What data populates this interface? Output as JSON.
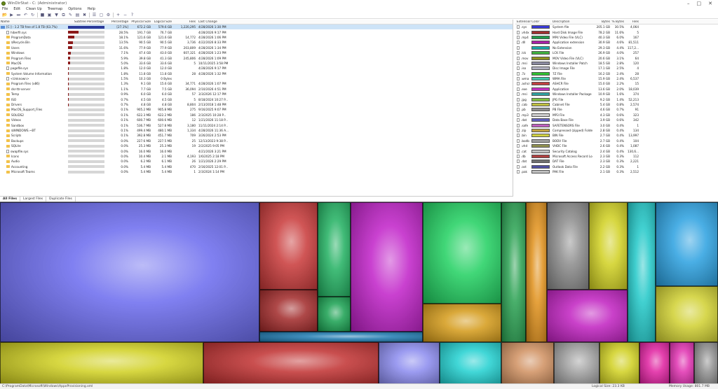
{
  "window": {
    "title": "WinDirStat - C: (Administrator)"
  },
  "menu": [
    "File",
    "Edit",
    "Clean Up",
    "Treemap",
    "Options",
    "Help"
  ],
  "toolbar_icons": [
    "open-icon",
    "play-icon",
    "next-icon",
    "back-icon",
    "refresh-icon",
    "stop-icon",
    "select-icon",
    "filter-icon",
    "copy-icon",
    "rename-icon",
    "explorer-icon",
    "delete-icon",
    "properties-icon",
    "folder-icon",
    "settings-icon",
    "zoom-in-icon",
    "zoom-out-icon",
    "help-icon"
  ],
  "tree": {
    "columns": [
      "Name",
      "Subtree Percentage",
      "Percentage",
      "Physical Size",
      "Logical Size",
      "Files",
      "Last Change"
    ],
    "rows": [
      {
        "name": "[C:] - 1.2 TB free of 1.8 TB (63.7%)",
        "type": "drive",
        "bar": 1.0,
        "pct": "[27.1%]",
        "phy": "672.2 GB",
        "log": "579.6 GB",
        "files": "1,220,295",
        "last": "4/28/2026 1:30 PM",
        "sel": true
      },
      {
        "name": "hiberfil.sys",
        "type": "file",
        "bar": 0.28,
        "pct": "28.5%",
        "phy": "191.7 GB",
        "log": "76.7 GB",
        "files": "",
        "last": "4/28/2026 9:17 PM"
      },
      {
        "name": "ProgramData",
        "type": "folder",
        "bar": 0.18,
        "pct": "18.1%",
        "phy": "121.6 GB",
        "log": "121.6 GB",
        "files": "14,772",
        "last": "4/28/2026 1:06 PM"
      },
      {
        "name": "$Recycle.Bin",
        "type": "folder",
        "bar": 0.13,
        "pct": "13.5%",
        "phy": "90.5 GB",
        "log": "90.5 GB",
        "files": "3,736",
        "last": "4/22/2026 8:33 PM"
      },
      {
        "name": "Users",
        "type": "folder",
        "bar": 0.12,
        "pct": "11.6%",
        "phy": "77.9 GB",
        "log": "77.9 GB",
        "files": "203,809",
        "last": "4/28/2026 1:34 PM"
      },
      {
        "name": "Windows",
        "type": "folder",
        "bar": 0.07,
        "pct": "7.1%",
        "phy": "47.4 GB",
        "log": "43.0 GB",
        "files": "607,321",
        "last": "4/28/2026 1:23 PM"
      },
      {
        "name": "Program Files",
        "type": "folder",
        "bar": 0.06,
        "pct": "5.9%",
        "phy": "39.8 GB",
        "log": "41.3 GB",
        "files": "245,806",
        "last": "4/28/2026 1:09 PM"
      },
      {
        "name": "MacOS",
        "type": "folder",
        "bar": 0.05,
        "pct": "5.0%",
        "phy": "33.6 GB",
        "log": "33.6 GB",
        "files": "5",
        "last": "10/11/2025 3:58 PM"
      },
      {
        "name": "pagefile.sys",
        "type": "file",
        "bar": 0.02,
        "pct": "1.8%",
        "phy": "12.0 GB",
        "log": "12.0 GB",
        "files": "",
        "last": "4/28/2026 9:17 PM"
      },
      {
        "name": "System Volume Information",
        "type": "folder",
        "bar": 0.02,
        "pct": "1.8%",
        "phy": "11.8 GB",
        "log": "11.8 GB",
        "files": "28",
        "last": "4/28/2026 1:32 PM"
      },
      {
        "name": "<Unknown>",
        "type": "file",
        "bar": 0.015,
        "pct": "1.5%",
        "phy": "10.3 GB",
        "log": "0 Bytes",
        "files": "",
        "last": ""
      },
      {
        "name": "Program Files (x86)",
        "type": "folder",
        "bar": 0.013,
        "pct": "1.3%",
        "phy": "9.1 GB",
        "log": "15.6 GB",
        "files": "34,771",
        "last": "4/28/2026 1:07 PM"
      },
      {
        "name": "dsr-ttr-server",
        "type": "folder",
        "bar": 0.011,
        "pct": "1.1%",
        "phy": "7.7 GB",
        "log": "7.5 GB",
        "files": "36,094",
        "last": "2/10/2026 4:51 PM"
      },
      {
        "name": "Temp",
        "type": "folder",
        "bar": 0.009,
        "pct": "0.9%",
        "phy": "6.0 GB",
        "log": "6.0 GB",
        "files": "57",
        "last": "3/3/2026 12:17 PM"
      },
      {
        "name": "ISO",
        "type": "folder",
        "bar": 0.007,
        "pct": "0.7%",
        "phy": "4.5 GB",
        "log": "4.5 GB",
        "files": "5",
        "last": "8/18/2024 10:27 P..."
      },
      {
        "name": "Drivers",
        "type": "folder",
        "bar": 0.007,
        "pct": "0.7%",
        "phy": "4.8 GB",
        "log": "4.8 GB",
        "files": "8,804",
        "last": "2/13/2018 1:48 PM"
      },
      {
        "name": "MacOS_Support_Files",
        "type": "folder",
        "bar": 0.001,
        "pct": "0.1%",
        "phy": "905.2 MB",
        "log": "905.8 MB",
        "files": "275",
        "last": "9/16/2025 9:07 PM"
      },
      {
        "name": "SOLIDS2",
        "type": "folder",
        "bar": 0.001,
        "pct": "0.1%",
        "phy": "622.3 MB",
        "log": "622.2 MB",
        "files": "186",
        "last": "2/3/2025 10:28 P..."
      },
      {
        "name": "Videos",
        "type": "folder",
        "bar": 0.001,
        "pct": "0.1%",
        "phy": "600.7 MB",
        "log": "600.6 MB",
        "files": "12",
        "last": "1/21/2026 11:18 P..."
      },
      {
        "name": "Sandbox",
        "type": "folder",
        "bar": 0.001,
        "pct": "0.1%",
        "phy": "536.7 MB",
        "log": "527.8 MB",
        "files": "3,180",
        "last": "11/11/2024 2:14 P..."
      },
      {
        "name": "$WINDOWS.~BT",
        "type": "folder",
        "bar": 0.001,
        "pct": "0.1%",
        "phy": "499.4 MB",
        "log": "480.1 MB",
        "files": "1,334",
        "last": "4/28/2026 11:36 A..."
      },
      {
        "name": "Scripts",
        "type": "folder",
        "bar": 0.001,
        "pct": "0.1%",
        "phy": "392.8 MB",
        "log": "451.7 MB",
        "files": "709",
        "last": "3/26/2024 2:53 PM"
      },
      {
        "name": "Backups",
        "type": "folder",
        "bar": 0.0,
        "pct": "0.0%",
        "phy": "227.6 MB",
        "log": "227.5 MB",
        "files": "25",
        "last": "12/13/2023 9:38 P..."
      },
      {
        "name": "SQLite",
        "type": "folder",
        "bar": 0.0,
        "pct": "0.0%",
        "phy": "25.3 MB",
        "log": "25.3 MB",
        "files": "19",
        "last": "2/2/2025 9:05 PM"
      },
      {
        "name": "swapfile.sys",
        "type": "file",
        "bar": 0.0,
        "pct": "0.0%",
        "phy": "16.0 MB",
        "log": "16.0 MB",
        "files": "",
        "last": "4/21/2026 3:21 PM"
      },
      {
        "name": "Icons",
        "type": "folder",
        "bar": 0.0,
        "pct": "0.0%",
        "phy": "10.4 MB",
        "log": "2.1 MB",
        "files": "4,193",
        "last": "1/6/2025 2:18 PM"
      },
      {
        "name": "Audio",
        "type": "folder",
        "bar": 0.0,
        "pct": "0.0%",
        "phy": "6.2 MB",
        "log": "6.1 MB",
        "files": "26",
        "last": "1/21/2026 2:29 PM"
      },
      {
        "name": "Accounting",
        "type": "folder",
        "bar": 0.0,
        "pct": "0.0%",
        "phy": "5.4 MB",
        "log": "5.4 MB",
        "files": "470",
        "last": "2/16/2025 12:01 P..."
      },
      {
        "name": "Microsoft Teams",
        "type": "folder",
        "bar": 0.0,
        "pct": "0.0%",
        "phy": "5.4 MB",
        "log": "5.4 MB",
        "files": "1",
        "last": "2/3/2024 1:14 PM"
      }
    ]
  },
  "tabs": [
    "All Files",
    "Largest Files",
    "Duplicate Files"
  ],
  "extensions": {
    "columns": [
      "Extension",
      "Color",
      "Description",
      "Bytes",
      "% Bytes",
      "Files"
    ],
    "rows": [
      {
        "ext": ".sys",
        "color": "#3a3ad8",
        "desc": "System file",
        "bytes": "205.1 GB",
        "pct": "30.5%",
        "files": "4,064"
      },
      {
        "ext": ".vhdx",
        "color": "#a03030",
        "desc": "Hard Disk Image File",
        "bytes": "78.2 GB",
        "pct": "11.6%",
        "files": "5"
      },
      {
        "ext": ".mp4",
        "color": "#1f9a4a",
        "desc": "MP4 Video File (VLC)",
        "bytes": "40.3 GB",
        "pct": "6.0%",
        "files": "167"
      },
      {
        "ext": ".dll",
        "color": "#a820a8",
        "desc": "Application extension",
        "bytes": "30.9 GB",
        "pct": "4.6%",
        "files": "81,511"
      },
      {
        "ext": "",
        "color": "#18a8a8",
        "desc": "No Extension",
        "bytes": "29.3 GB",
        "pct": "4.4%",
        "files": "117,2..."
      },
      {
        "ext": ".lck",
        "color": "#40b040",
        "desc": "LCK File",
        "bytes": "26.9 GB",
        "pct": "4.0%",
        "files": "257"
      },
      {
        "ext": ".mov",
        "color": "#909020",
        "desc": "MOV Video File (VLC)",
        "bytes": "20.6 GB",
        "pct": "3.1%",
        "files": "64"
      },
      {
        "ext": ".msi",
        "color": "#8a8aa0",
        "desc": "Windows Installer Patch",
        "bytes": "18.5 GB",
        "pct": "2.8%",
        "files": "120"
      },
      {
        "ext": ".iso",
        "color": "#b0b0c0",
        "desc": "Disc Image File",
        "bytes": "17.1 GB",
        "pct": "2.5%",
        "files": "4"
      },
      {
        "ext": ".7z",
        "color": "#30c030",
        "desc": "7Z File",
        "bytes": "16.2 GB",
        "pct": "2.4%",
        "files": "28"
      },
      {
        "ext": ".wma",
        "color": "#40c8a8",
        "desc": "WMA File",
        "bytes": "15.9 GB",
        "pct": "2.4%",
        "files": "6,537"
      },
      {
        "ext": ".ashcr",
        "color": "#c04040",
        "desc": "ASHCR File",
        "bytes": "15.0 GB",
        "pct": "2.2%",
        "files": "15"
      },
      {
        "ext": ".exe",
        "color": "#c030c0",
        "desc": "Application",
        "bytes": "13.6 GB",
        "pct": "2.0%",
        "files": "18,039"
      },
      {
        "ext": ".msi",
        "color": "#30a0a0",
        "desc": "Windows Installer Package",
        "bytes": "10.9 GB",
        "pct": "1.6%",
        "files": "374"
      },
      {
        "ext": ".jpg",
        "color": "#80c040",
        "desc": "JPG File",
        "bytes": "9.2 GB",
        "pct": "1.4%",
        "files": "52,213"
      },
      {
        "ext": ".cab",
        "color": "#c0c040",
        "desc": "Cabinet File",
        "bytes": "5.4 GB",
        "pct": "0.8%",
        "files": "2,574"
      },
      {
        "ext": ".pb",
        "color": "#909090",
        "desc": "PB File",
        "bytes": "4.6 GB",
        "pct": "0.7%",
        "files": "91"
      },
      {
        "ext": ".mp3",
        "color": "#d0d0d0",
        "desc": "MP3 File",
        "bytes": "4.3 GB",
        "pct": "0.6%",
        "files": "323"
      },
      {
        "ext": ".dat",
        "color": "#6060c0",
        "desc": "Data Base File",
        "bytes": "3.9 GB",
        "pct": "0.6%",
        "files": "342"
      },
      {
        "ext": ".safe",
        "color": "#c060c0",
        "desc": "SAFETENSORS File",
        "bytes": "3.0 GB",
        "pct": "0.4%",
        "files": "1"
      },
      {
        "ext": ".zip",
        "color": "#c0a040",
        "desc": "Compressed (zipped) Folder",
        "bytes": "2.8 GB",
        "pct": "0.4%",
        "files": "134"
      },
      {
        "ext": ".bin",
        "color": "#d0d040",
        "desc": "BIN File",
        "bytes": "2.7 GB",
        "pct": "0.4%",
        "files": "13,997"
      },
      {
        "ext": ".bodb",
        "color": "#a0a0a0",
        "desc": "BODV File",
        "bytes": "2.7 GB",
        "pct": "0.4%",
        "files": "104"
      },
      {
        "ext": ".vhd",
        "color": "#909050",
        "desc": "VHDC File",
        "bytes": "2.6 GB",
        "pct": "0.4%",
        "files": "1,087"
      },
      {
        "ext": ".cat",
        "color": "#c0c0c0",
        "desc": "Security Catalog",
        "bytes": "2.4 GB",
        "pct": "0.4%",
        "files": "130,6..."
      },
      {
        "ext": ".db",
        "color": "#b04040",
        "desc": "Microsoft Access Record Loc...",
        "bytes": "2.3 GB",
        "pct": "0.3%",
        "files": "112"
      },
      {
        "ext": ".dat",
        "color": "#707070",
        "desc": "DAT File",
        "bytes": "2.3 GB",
        "pct": "0.3%",
        "files": "2,221"
      },
      {
        "ext": ".ost",
        "color": "#5050a0",
        "desc": "Outlook Data File",
        "bytes": "2.2 GB",
        "pct": "0.3%",
        "files": "1"
      },
      {
        "ext": ".pak",
        "color": "#c0c0c0",
        "desc": "PAK File",
        "bytes": "2.1 GB",
        "pct": "0.3%",
        "files": "2,512"
      }
    ]
  },
  "treemap": {
    "tiles": [
      {
        "region": [
          0,
          0,
          370,
          200
        ],
        "color": "#6a6aee"
      },
      {
        "region": [
          370,
          0,
          453,
          125
        ],
        "color": "#c83838"
      },
      {
        "region": [
          453,
          0,
          500,
          135
        ],
        "color": "#20b060"
      },
      {
        "region": [
          500,
          0,
          603,
          185
        ],
        "color": "#c020c8"
      },
      {
        "region": [
          603,
          0,
          715,
          145
        ],
        "color": "#20d060"
      },
      {
        "region": [
          603,
          145,
          715,
          200
        ],
        "color": "#d49a18"
      },
      {
        "region": [
          715,
          0,
          750,
          200
        ],
        "color": "#28a050"
      },
      {
        "region": [
          750,
          0,
          780,
          200
        ],
        "color": "#e0901a"
      },
      {
        "region": [
          780,
          0,
          840,
          125
        ],
        "color": "#8a8a8a"
      },
      {
        "region": [
          780,
          125,
          895,
          200
        ],
        "color": "#c020c0"
      },
      {
        "region": [
          840,
          0,
          895,
          125
        ],
        "color": "#d0d020"
      },
      {
        "region": [
          895,
          0,
          935,
          200
        ],
        "color": "#20c8c8"
      },
      {
        "region": [
          935,
          0,
          1024,
          120
        ],
        "color": "#2aa0e0"
      },
      {
        "region": [
          935,
          120,
          1024,
          200
        ],
        "color": "#d0d030"
      },
      {
        "region": [
          370,
          125,
          453,
          185
        ],
        "color": "#a02828"
      },
      {
        "region": [
          453,
          135,
          500,
          185
        ],
        "color": "#18a050"
      },
      {
        "region": [
          370,
          185,
          603,
          200
        ],
        "color": "#1e7ab0"
      },
      {
        "region": [
          0,
          200,
          290,
          260
        ],
        "color": "#d0d020"
      },
      {
        "region": [
          290,
          200,
          540,
          260
        ],
        "color": "#c03030"
      },
      {
        "region": [
          540,
          200,
          627,
          260
        ],
        "color": "#8a8aee"
      },
      {
        "region": [
          627,
          200,
          715,
          260
        ],
        "color": "#20d0d0"
      },
      {
        "region": [
          715,
          200,
          790,
          260
        ],
        "color": "#d09060"
      },
      {
        "region": [
          790,
          200,
          855,
          260
        ],
        "color": "#a0a0a0"
      },
      {
        "region": [
          855,
          200,
          912,
          260
        ],
        "color": "#d0d020"
      },
      {
        "region": [
          912,
          200,
          955,
          260
        ],
        "color": "#e020a0"
      },
      {
        "region": [
          955,
          200,
          990,
          260
        ],
        "color": "#e030b0"
      },
      {
        "region": [
          990,
          200,
          1024,
          260
        ],
        "color": "#909090"
      }
    ]
  },
  "status": {
    "path": "C:\\ProgramData\\Microsoft\\Windows\\AppxProvisioning.xml",
    "logical": "Logical Size: 23.3 KB",
    "memory": "Memory Usage: 801.7 MB"
  }
}
